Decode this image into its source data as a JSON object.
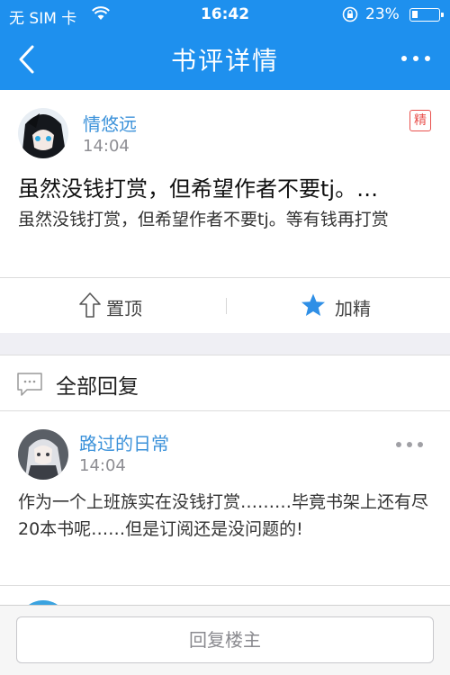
{
  "status": {
    "carrier": "无 SIM 卡",
    "time": "16:42",
    "battery_pct": "23%",
    "battery_level": 0.23
  },
  "nav": {
    "title": "书评详情",
    "back_icon": "chevron-left-icon",
    "more_icon": "more-dots-icon"
  },
  "post": {
    "username": "情悠远",
    "time": "14:04",
    "badge": "精",
    "title": "虽然没钱打赏，但希望作者不要tj。…",
    "body": "虽然没钱打赏，但希望作者不要tj。等有钱再打赏",
    "actions": {
      "pin_label": "置顶",
      "feature_label": "加精"
    }
  },
  "replies": {
    "header": "全部回复",
    "items": [
      {
        "username": "路过的日常",
        "time": "14:04",
        "body": "作为一个上班族实在没钱打赏………毕竟书架上还有尽20本书呢……但是订阅还是没问题的!"
      }
    ]
  },
  "bottom": {
    "reply_button": "回复楼主"
  },
  "colors": {
    "brand": "#1e90ee",
    "username": "#3c92da",
    "badge": "#e8514d",
    "star": "#2f8fe6"
  }
}
